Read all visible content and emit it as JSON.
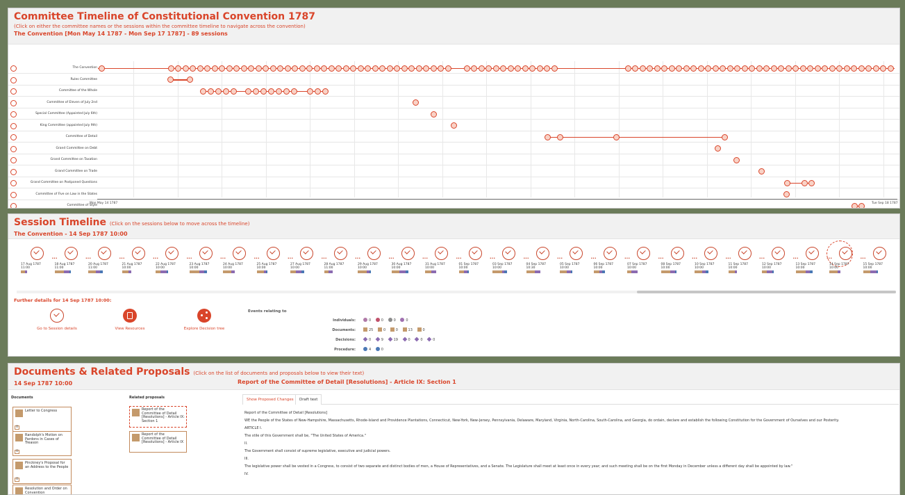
{
  "committee": {
    "title": "Committee Timeline of Constitutional Convention 1787",
    "instruction": "(Click on either the committee names or the sessions within the committee timeline to navigate across the convention)",
    "subtitle": "The Convention [Mon May 14 1787 - Mon Sep 17 1787] - 89 sessions",
    "rows": [
      "The Convention",
      "Rules Committee",
      "Committee of the Whole",
      "Committee of Eleven of July 2nd",
      "Special Committee (Appointed July 6th)",
      "King Committee (appointed July 9th)",
      "Committee of Detail",
      "Grand Committee on Debt",
      "Grand Committee on Taxation",
      "Grand Committee on Trade",
      "Grand Committee on Postponed Questions",
      "Committee of Five on Law in the States",
      "Committee of Style"
    ],
    "axis_start": "Mon May 14 1787",
    "axis_end": "Tue Sep 18 1787"
  },
  "session": {
    "title": "Session Timeline",
    "hint": "(Click on the sessions below to move across the timeline)",
    "subtitle": "The Convention - 14 Sep 1787 10:00",
    "sessions": [
      {
        "date": "17 Aug 1787",
        "time": "11:00"
      },
      {
        "date": "18 Aug 1787",
        "time": "11:00"
      },
      {
        "date": "20 Aug 1787",
        "time": "11:00"
      },
      {
        "date": "21 Aug 1787",
        "time": "10:00"
      },
      {
        "date": "22 Aug 1787",
        "time": "10:00"
      },
      {
        "date": "23 Aug 1787",
        "time": "10:00"
      },
      {
        "date": "24 Aug 1787",
        "time": "10:00"
      },
      {
        "date": "25 Aug 1787",
        "time": "10:00"
      },
      {
        "date": "27 Aug 1787",
        "time": "10:00"
      },
      {
        "date": "28 Aug 1787",
        "time": "11:00"
      },
      {
        "date": "29 Aug 1787",
        "time": "10:00"
      },
      {
        "date": "30 Aug 1787",
        "time": "10:00"
      },
      {
        "date": "31 Aug 1787",
        "time": "10:00"
      },
      {
        "date": "01 Sep 1787",
        "time": "10:00"
      },
      {
        "date": "03 Sep 1787",
        "time": "10:00"
      },
      {
        "date": "04 Sep 1787",
        "time": "10:30"
      },
      {
        "date": "05 Sep 1787",
        "time": "10:00"
      },
      {
        "date": "06 Sep 1787",
        "time": "10:00"
      },
      {
        "date": "07 Sep 1787",
        "time": "10:00"
      },
      {
        "date": "08 Sep 1787",
        "time": "10:00"
      },
      {
        "date": "10 Sep 1787",
        "time": "10:00"
      },
      {
        "date": "11 Sep 1787",
        "time": "10:00"
      },
      {
        "date": "12 Sep 1787",
        "time": "10:00"
      },
      {
        "date": "13 Sep 1787",
        "time": "10:00"
      },
      {
        "date": "14 Sep 1787",
        "time": "10:00"
      },
      {
        "date": "15 Sep 1787",
        "time": "10:00"
      }
    ],
    "selected_index": 24,
    "further": "Further details for 14 Sep 1787 10:00:",
    "actions": {
      "details": "Go to Session details",
      "resources": "View Resources",
      "tree": "Explore Decision tree"
    },
    "events_title": "Events relating to",
    "events": {
      "individuals_label": "Individuals:",
      "individuals": [
        "0",
        "0",
        "0",
        "0"
      ],
      "documents_label": "Documents:",
      "documents": [
        "25",
        "0",
        "0",
        "13",
        "0"
      ],
      "decisions_label": "Decisions:",
      "decisions": [
        "0",
        "9",
        "19",
        "0",
        "0",
        "0"
      ],
      "procedure_label": "Procedure:",
      "procedure": [
        "4",
        "0"
      ]
    }
  },
  "documents": {
    "title": "Documents & Related Proposals",
    "hint": "(Click on the list of documents and proposals below to view their text)",
    "date": "14 Sep 1787 10:00",
    "doc_title": "Report of the Committee of Detail [Resolutions] - Article IX: Section 1",
    "documents_label": "Documents",
    "related_label": "Related proposals",
    "docs": [
      {
        "title": "Letter to Congress",
        "count": "0"
      },
      {
        "title": "Randolph's Motion on Pardons in Cases of Treason",
        "count": "0"
      },
      {
        "title": "Pinckney's Proposal for an Address to the People",
        "count": "0"
      },
      {
        "title": "Resolution and Order on Convention",
        "count": ""
      }
    ],
    "proposals": [
      "Report of the Committee of Detail [Resolutions] - Article IX: Section 1",
      "Report of the Committee of Detail [Resolutions] - Article IX"
    ],
    "tabs": [
      "Show Proposed Changes",
      "Draft text"
    ],
    "text": [
      "Report of the Committee of Detail [Resolutions]",
      "WE the People of the States of New-Hampshire, Massachusetts, Rhode-Island and Providence Plantations, Connecticut, New-York, New-Jersey, Pennsylvania, Delaware, Maryland, Virginia, North-Carolina, South-Carolina, and Georgia, do ordain, declare and establish the following Constitution for the Government of Ourselves and our Posterity.",
      "ARTICLE I.",
      "The stile of this Government shall be, \"The United States of America.\"",
      "II.",
      "The Government shall consist of supreme legislative, executive and judicial powers.",
      "III.",
      "The legislative power shall be vested in a Congress, to consist of two separate and distinct bodies of men, a House of Representatives, and a Senate. The Legislature shall meet at least once in every year; and such meeting shall be on the first Monday in December unless a different day shall be appointed by law.\"",
      "IV."
    ]
  },
  "colors": {
    "accent": "#d9452a",
    "frame": "#6b7b5a",
    "doc_brown": "#c49a6c",
    "decision_purple": "#8c6bb1",
    "procedure_blue": "#4a78b5"
  }
}
